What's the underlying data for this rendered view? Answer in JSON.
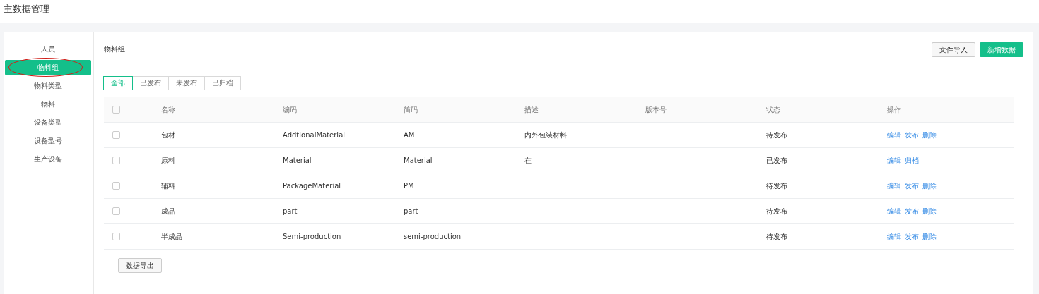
{
  "page_title": "主数据管理",
  "sidebar": {
    "items": [
      {
        "label": "人员",
        "selected": false,
        "circled": false
      },
      {
        "label": "物料组",
        "selected": true,
        "circled": true
      },
      {
        "label": "物料类型",
        "selected": false,
        "circled": false
      },
      {
        "label": "物料",
        "selected": false,
        "circled": false
      },
      {
        "label": "设备类型",
        "selected": false,
        "circled": false
      },
      {
        "label": "设备型号",
        "selected": false,
        "circled": false
      },
      {
        "label": "生产设备",
        "selected": false,
        "circled": false
      }
    ]
  },
  "section_title": "物料组",
  "buttons": [
    {
      "label": "文件导入",
      "kind": "default"
    },
    {
      "label": "新增数据",
      "kind": "primary"
    }
  ],
  "tabs": [
    {
      "label": "全部",
      "selected": true
    },
    {
      "label": "已发布",
      "selected": false
    },
    {
      "label": "未发布",
      "selected": false
    },
    {
      "label": "已归档",
      "selected": false
    }
  ],
  "table": {
    "header_checked": false,
    "columns": [
      "名称",
      "编码",
      "简码",
      "描述",
      "版本号",
      "状态",
      "操作"
    ],
    "rows": [
      {
        "checked": false,
        "cells": [
          "包材",
          "AddtionalMaterial",
          "AM",
          "内外包装材料",
          "",
          "待发布"
        ],
        "actions": [
          "编辑",
          "发布",
          "删除"
        ]
      },
      {
        "checked": false,
        "cells": [
          "原料",
          "Material",
          "Material",
          "在",
          "",
          "已发布"
        ],
        "actions": [
          "编辑",
          "归档"
        ]
      },
      {
        "checked": false,
        "cells": [
          "辅料",
          "PackageMaterial",
          "PM",
          "",
          "",
          "待发布"
        ],
        "actions": [
          "编辑",
          "发布",
          "删除"
        ]
      },
      {
        "checked": false,
        "cells": [
          "成品",
          "part",
          "part",
          "",
          "",
          "待发布"
        ],
        "actions": [
          "编辑",
          "发布",
          "删除"
        ]
      },
      {
        "checked": false,
        "cells": [
          "半成品",
          "Semi-production",
          "semi-production",
          "",
          "",
          "待发布"
        ],
        "actions": [
          "编辑",
          "发布",
          "删除"
        ]
      }
    ]
  },
  "export_button": "数据导出"
}
